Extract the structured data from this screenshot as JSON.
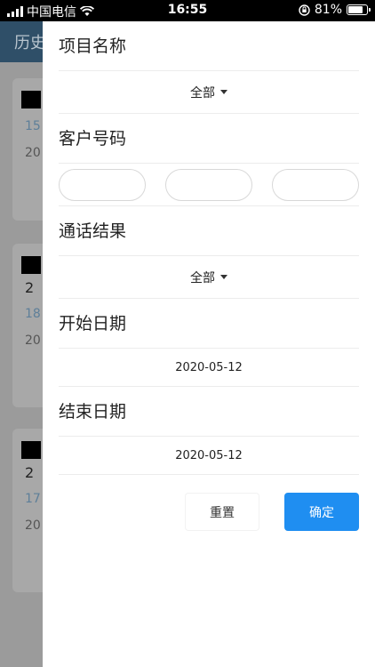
{
  "status_bar": {
    "carrier": "中国电信",
    "time": "16:55",
    "battery": "81%",
    "battery_level": 0.81
  },
  "background": {
    "header_title": "历史",
    "cards": [
      {
        "number": "",
        "line1": "15",
        "line2": "20"
      },
      {
        "number": "2",
        "line1": "18",
        "line2": "20"
      },
      {
        "number": "2",
        "line1": "17",
        "line2": "20"
      }
    ]
  },
  "filter": {
    "project_label": "项目名称",
    "project_value": "全部",
    "customer_label": "客户号码",
    "customer_inputs": [
      "",
      "",
      ""
    ],
    "result_label": "通话结果",
    "result_value": "全部",
    "start_label": "开始日期",
    "start_value": "2020-05-12",
    "end_label": "结束日期",
    "end_value": "2020-05-12",
    "reset_label": "重置",
    "confirm_label": "确定"
  }
}
